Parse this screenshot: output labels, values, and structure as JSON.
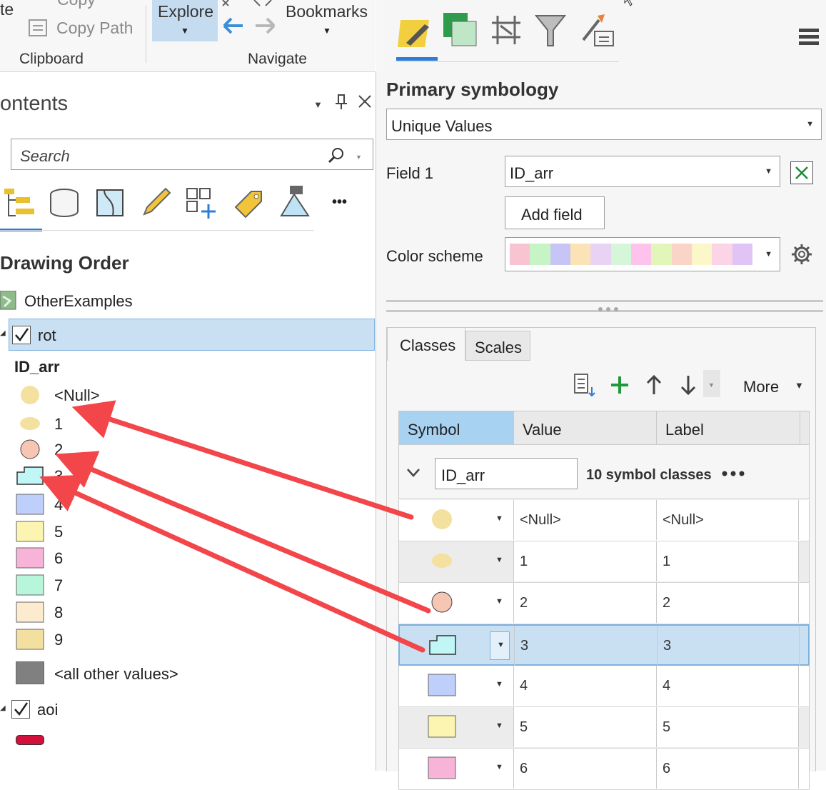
{
  "ribbon": {
    "paste_fragment": "te",
    "copy_fragment": "Copy",
    "copy_path": "Copy Path",
    "clipboard_group": "Clipboard",
    "explore": "Explore",
    "bookmarks": "Bookmarks",
    "navigate_group": "Navigate"
  },
  "contents": {
    "title": "ontents",
    "search_placeholder": "Search",
    "more_dots": "•••",
    "drawing_order": "Drawing Order",
    "map_name": "OtherExamples",
    "layer1": {
      "name": "rot",
      "checked": true,
      "field": "ID_arr"
    },
    "legend": [
      {
        "label": "<Null>",
        "shape": "circle",
        "color": "#f4e19f"
      },
      {
        "label": "1",
        "shape": "ellipse",
        "color": "#f4e19f"
      },
      {
        "label": "2",
        "shape": "circle",
        "color": "#f6c6b3"
      },
      {
        "label": "3",
        "shape": "folder",
        "color": "#c1f6f6"
      },
      {
        "label": "4",
        "shape": "square",
        "color": "#bfcffb"
      },
      {
        "label": "5",
        "shape": "square",
        "color": "#fcf4b1"
      },
      {
        "label": "6",
        "shape": "square",
        "color": "#f8b4d8"
      },
      {
        "label": "7",
        "shape": "square",
        "color": "#b8f6dc"
      },
      {
        "label": "8",
        "shape": "square",
        "color": "#fdebd0"
      },
      {
        "label": "9",
        "shape": "square",
        "color": "#f3e0a1"
      }
    ],
    "other_values": {
      "label": "<all other values>",
      "color": "#808080"
    },
    "layer2": {
      "name": "aoi",
      "checked": true,
      "line_color": "#d1113c"
    }
  },
  "symbology": {
    "primary_label": "Primary symbology",
    "method": "Unique Values",
    "field1_label": "Field 1",
    "field1_value": "ID_arr",
    "add_field": "Add field",
    "color_scheme_label": "Color scheme",
    "scheme_colors": [
      "#f9c4d2",
      "#c6f4c4",
      "#c7c5f5",
      "#fbe3b6",
      "#e9d3f4",
      "#d5f6d9",
      "#fdc3ec",
      "#e3f6b9",
      "#fbd4c8",
      "#fbf7c9",
      "#fbd4e8",
      "#e1c4f6"
    ],
    "tabs": [
      "Classes",
      "Scales"
    ],
    "more": "More",
    "columns": [
      "Symbol",
      "Value",
      "Label"
    ],
    "group_field": "ID_arr",
    "group_count": "10 symbol classes",
    "rows": [
      {
        "value": "<Null>",
        "label": "<Null>",
        "shape": "circle",
        "color": "#f4e19f"
      },
      {
        "value": "1",
        "label": "1",
        "shape": "ellipse",
        "color": "#f4e19f"
      },
      {
        "value": "2",
        "label": "2",
        "shape": "circle",
        "color": "#f6c6b3"
      },
      {
        "value": "3",
        "label": "3",
        "shape": "folder",
        "color": "#c1f6f6",
        "selected": true
      },
      {
        "value": "4",
        "label": "4",
        "shape": "square",
        "color": "#bfcffb"
      },
      {
        "value": "5",
        "label": "5",
        "shape": "square",
        "color": "#fcf4b1"
      },
      {
        "value": "6",
        "label": "6",
        "shape": "square",
        "color": "#f8b4d8"
      }
    ]
  },
  "colors": {
    "accent_blue": "#c5dcf0",
    "selection": "#c9e0f3",
    "annotation_arrow": "#f2464a"
  }
}
